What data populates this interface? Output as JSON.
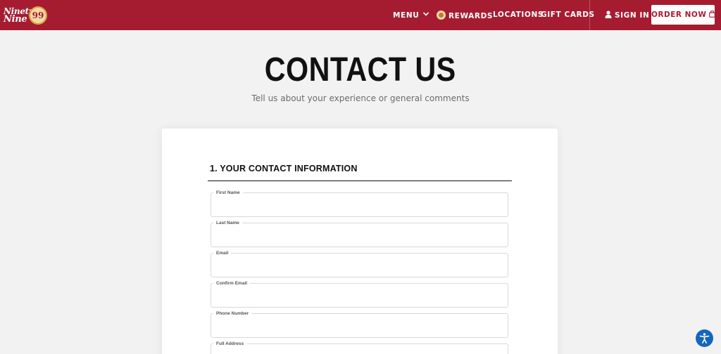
{
  "header": {
    "logo": {
      "line1": "Ninety",
      "line2": "Nine",
      "badge": "99"
    },
    "nav": {
      "menu": "MENU",
      "rewards": "REWARDS",
      "locations": "LOCATIONS",
      "gift_cards": "GIFT CARDS",
      "sign_in": "SIGN IN"
    },
    "order_button": "ORDER NOW"
  },
  "hero": {
    "title": "CONTACT US",
    "subtitle": "Tell us about your experience or general comments"
  },
  "form": {
    "section_title": "1. YOUR CONTACT INFORMATION",
    "fields": [
      {
        "label": "First Name",
        "value": ""
      },
      {
        "label": "Last Name",
        "value": ""
      },
      {
        "label": "Email",
        "value": ""
      },
      {
        "label": "Confirm Email",
        "value": ""
      },
      {
        "label": "Phone Number",
        "value": ""
      },
      {
        "label": "Full Address",
        "value": ""
      }
    ]
  },
  "colors": {
    "brand": "#a51c30",
    "background": "#f2f2f2",
    "accessibility": "#1565c0"
  },
  "icons": [
    "chevron-down-icon",
    "rewards-icon",
    "user-icon",
    "shopping-bag-icon",
    "accessibility-icon"
  ]
}
